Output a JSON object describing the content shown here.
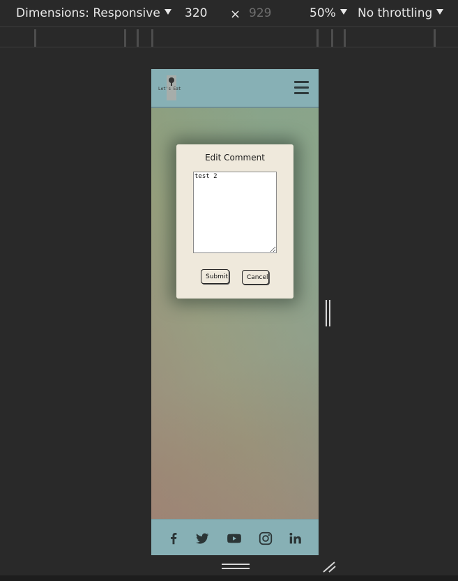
{
  "devtools": {
    "dimensions_label": "Dimensions: Responsive",
    "width_value": "320",
    "times_symbol": "×",
    "height_value": "929",
    "zoom_label": "50%",
    "throttling_label": "No throttling"
  },
  "site": {
    "logo_text": "Let's Eat",
    "menu_icon": "hamburger-icon",
    "colors": {
      "header_bg": "#87b0b5",
      "modal_bg": "#efe9dc"
    }
  },
  "modal": {
    "title": "Edit Comment",
    "comment_value": "test 2",
    "submit_label": "Submit",
    "cancel_label": "Cancel"
  },
  "footer": {
    "social_icons": [
      "facebook-icon",
      "twitter-icon",
      "youtube-icon",
      "instagram-icon",
      "linkedin-icon"
    ]
  }
}
